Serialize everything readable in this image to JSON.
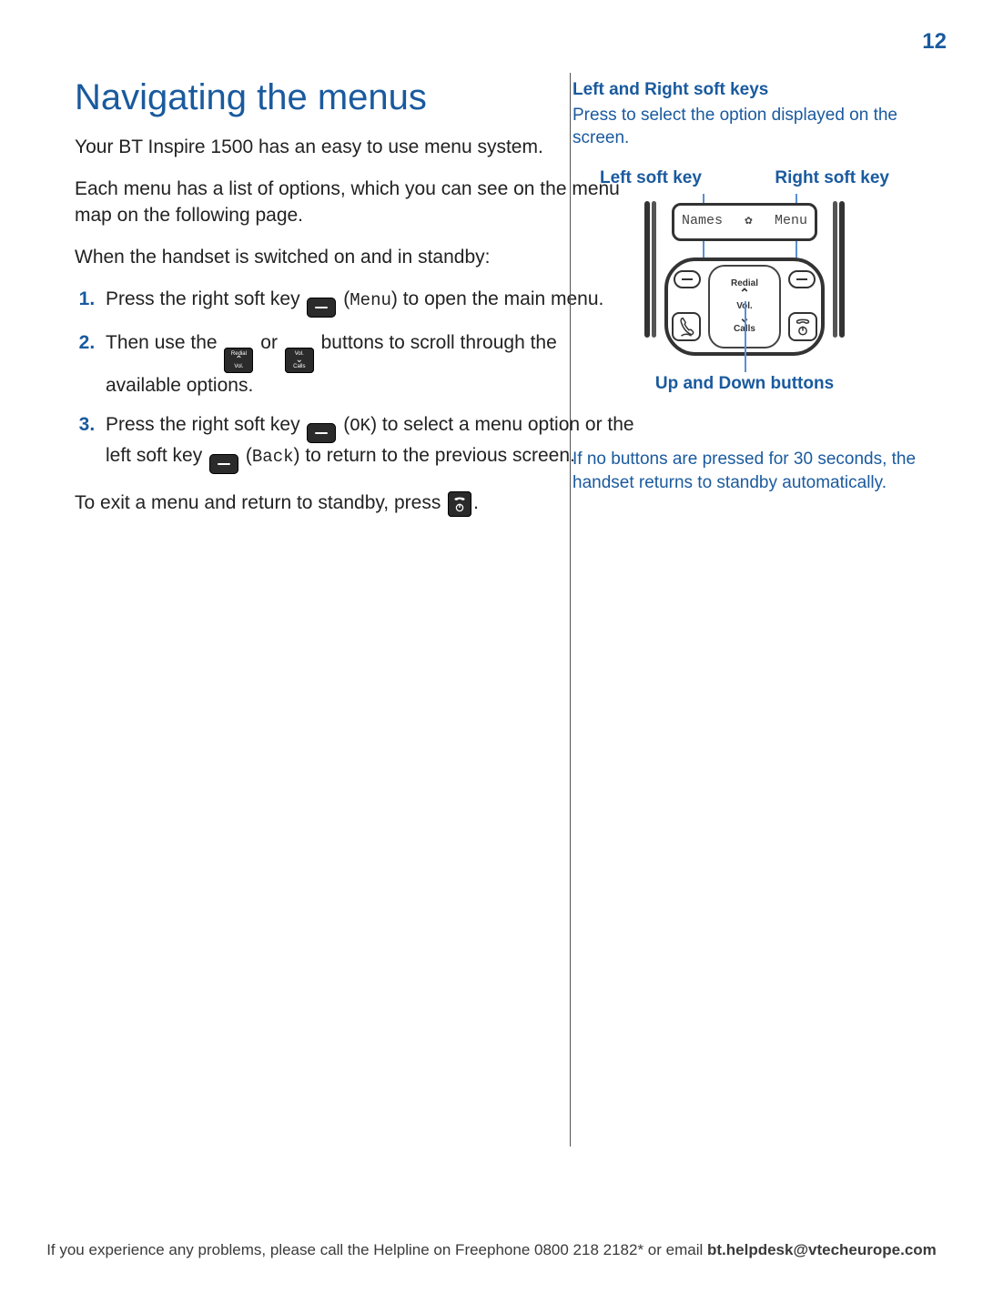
{
  "page_number": "12",
  "heading": "Navigating the menus",
  "intro_1": "Your BT Inspire 1500 has an easy to use menu system.",
  "intro_2": "Each menu has a list of options, which you can see on the menu map on the following page.",
  "intro_3": "When the handset is switched on and in standby:",
  "steps": {
    "s1_a": "Press the right soft key ",
    "s1_b": " (",
    "s1_menu": "Menu",
    "s1_c": ") to open the main menu.",
    "s2_a": "Then use the ",
    "s2_or": " or ",
    "s2_b": " buttons to scroll through the available options.",
    "s3_a": "Press the right soft key ",
    "s3_b": " (",
    "s3_ok": "OK",
    "s3_c": ") to select a menu option or the left soft key",
    "s3_d": " (",
    "s3_back": "Back",
    "s3_e": ") to return to the previous screen."
  },
  "exit_a": "To exit a menu and return to standby, press ",
  "exit_b": ".",
  "nav_key_1": {
    "top": "Redial",
    "bot": "Vol."
  },
  "nav_key_2": {
    "top": "Vol.",
    "bot": "Calls"
  },
  "sidebar": {
    "title": "Left and Right soft keys",
    "desc": "Press to select the option displayed on the screen.",
    "left_label": "Left soft key",
    "right_label": "Right soft key",
    "updown": "Up and Down buttons",
    "timeout": "If no buttons are pressed for 30 seconds, the handset returns to standby automatically."
  },
  "diagram": {
    "screen_left": "Names",
    "screen_right": "Menu",
    "dpad_top": "Redial",
    "dpad_mid": "Vol.",
    "dpad_bot": "Calls"
  },
  "footer": {
    "text_a": "If you experience any problems, please call the Helpline on Freephone 0800 218 2182* or email ",
    "email": "bt.helpdesk@vtecheurope.com"
  }
}
